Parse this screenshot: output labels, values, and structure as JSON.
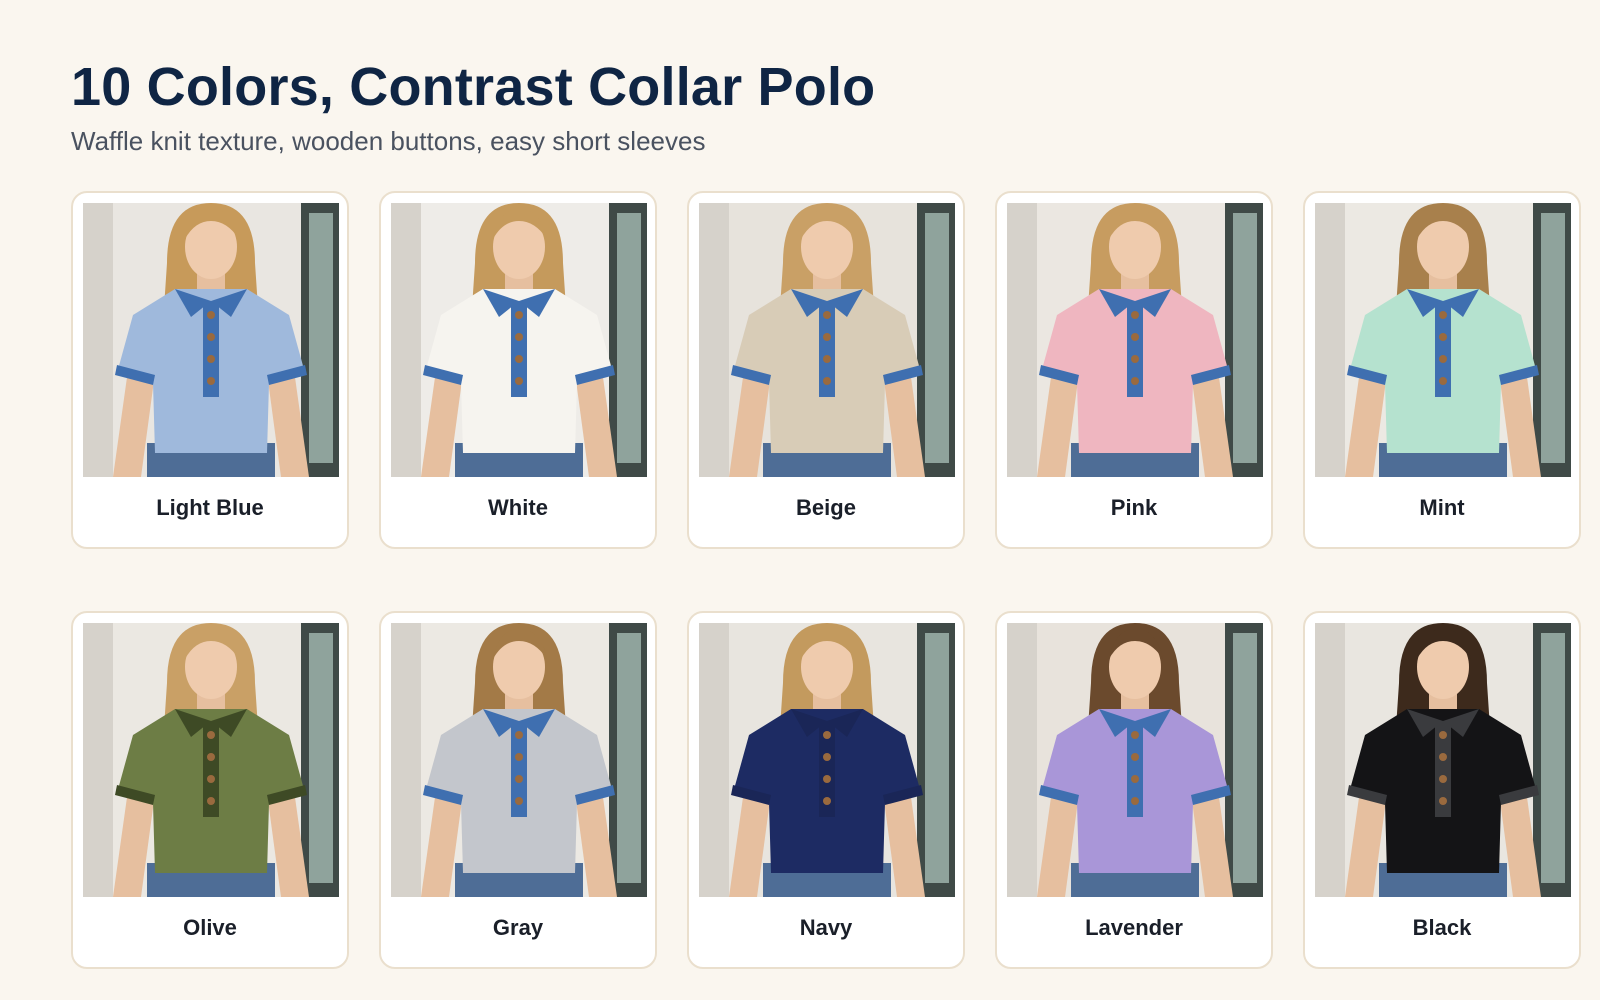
{
  "header": {
    "title": "10 Colors, Contrast Collar Polo",
    "subtitle": "Waffle knit texture, wooden buttons, easy short sleeves"
  },
  "products": [
    {
      "name": "Light Blue",
      "shirt": "#9fb9dc",
      "trim": "#3f6fb0",
      "bg": "#e9e6e1",
      "hair": "#c79a5a"
    },
    {
      "name": "White",
      "shirt": "#f6f4ef",
      "trim": "#3f6fb0",
      "bg": "#eeece8",
      "hair": "#c59a5c"
    },
    {
      "name": "Beige",
      "shirt": "#d8ccb7",
      "trim": "#3f6fb0",
      "bg": "#e7e3dc",
      "hair": "#c9a066"
    },
    {
      "name": "Pink",
      "shirt": "#efb6c0",
      "trim": "#3f6fb0",
      "bg": "#ebe7e1",
      "hair": "#c79c60"
    },
    {
      "name": "Mint",
      "shirt": "#b5e2cf",
      "trim": "#3f6fb0",
      "bg": "#ece9e3",
      "hair": "#a8804c"
    },
    {
      "name": "Olive",
      "shirt": "#6d7d45",
      "trim": "#3e4a25",
      "bg": "#ebe8e2",
      "hair": "#c9a066"
    },
    {
      "name": "Gray",
      "shirt": "#c3c6cc",
      "trim": "#3f6fb0",
      "bg": "#ece9e3",
      "hair": "#a37a47"
    },
    {
      "name": "Navy",
      "shirt": "#1d2b63",
      "trim": "#1a2657",
      "bg": "#e8e5df",
      "hair": "#c39a5e"
    },
    {
      "name": "Lavender",
      "shirt": "#a996d8",
      "trim": "#3f6fb0",
      "bg": "#e8e3dc",
      "hair": "#6b4a2d"
    },
    {
      "name": "Black",
      "shirt": "#141416",
      "trim": "#3a3b3e",
      "bg": "#e9e6e0",
      "hair": "#3d2a1c"
    }
  ]
}
